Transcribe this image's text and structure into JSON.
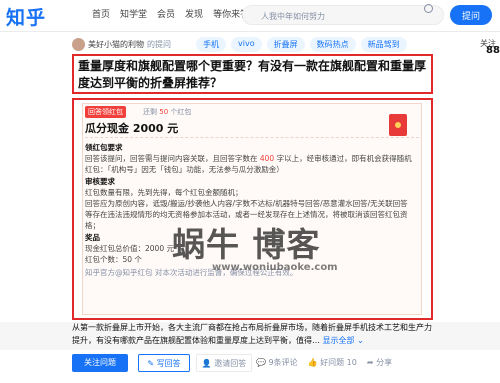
{
  "header": {
    "logo": "知乎",
    "nav": [
      "首页",
      "知学堂",
      "会员",
      "发现",
      "等你来答"
    ],
    "search_placeholder": "人我中年如何努力",
    "ask_label": "提问"
  },
  "question": {
    "author_name": "美好小猫的利物",
    "author_action": "的提问",
    "tags": [
      "手机",
      "vivo",
      "折叠屏",
      "数码热点",
      "新品驾到"
    ],
    "side_label": "关注",
    "side_count": "88",
    "title": "重量厚度和旗舰配置哪个更重要？有没有一款在旗舰配置和重量厚度达到平衡的折叠屏推荐？"
  },
  "hongbao": {
    "badge": "回答领红包",
    "remain_prefix": "还剩",
    "remain_count": "50",
    "remain_suffix": "个红包",
    "title": "瓜分现金 2000 元",
    "s1_head": "领红包要求",
    "s1_text_a": "回答该提问，回答需与提问内容关联，且回答字数在",
    "s1_num": "400",
    "s1_text_b": "字以上，经审核通过，即有机会获得随机红包：「机构号」因无「钱包」功能，无法参与瓜分激励金）",
    "s2_head": "审核要求",
    "s2_line1": "红包数量有限，先到先得，每个红包金额随机；",
    "s2_line2": "回答应为原创内容，诋毁/搬运/抄袭他人内容/字数不达标/机器特号回答/恶意灌水回答/无关联回答",
    "s2_line3": "等存在违法违规情形的均无资格参加本活动，或者一经发现存在上述情况，将被取消该回答红包资格；",
    "s3_head": "奖品",
    "s3_line1": "现金红包总价值：2000 元",
    "s3_line2": "红包个数：50 个",
    "footer": "知乎官方@知乎红包 对本次活动进行监督，确保过程公正有效。"
  },
  "watermark": {
    "big": "蜗牛   博客",
    "url": "www.woniubaoke.com"
  },
  "excerpt": {
    "text": "从第一款折叠屏上市开始，各大主流厂商都在抢占布局折叠屏市场，随着折叠屏手机技术工艺和生产力提升，有没有哪款产品在旗舰配置体验和重量厚度上达到平衡，值得…",
    "more": "显示全部 ⌄"
  },
  "actions": {
    "follow": "关注问题",
    "write": "✎ 写回答",
    "invite": "👤 邀请回答",
    "comments": "💬 9条评论",
    "like": "👍 好问题 10",
    "share": "➦ 分享"
  }
}
